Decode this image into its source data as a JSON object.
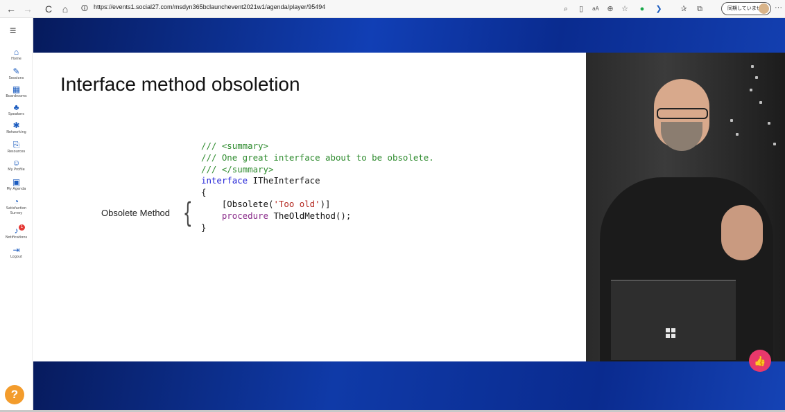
{
  "browser": {
    "back": "←",
    "forward": "→",
    "reload": "C",
    "home": "⌂",
    "lock": "🛈",
    "url": "https://events1.social27.com/msdyn365bclaunchevent2021w1/agenda/player/95494",
    "toolbar_icons": [
      "search-icon",
      "reader-icon",
      "font-icon",
      "zoom-icon",
      "favorites-add-icon",
      "extension-green-icon",
      "extension-blue-icon",
      "favorites-icon",
      "collections-icon"
    ],
    "profile_label": "同期していません",
    "more": "···"
  },
  "sidebar": {
    "menu": "≡",
    "items": [
      {
        "label": "Home",
        "icon": "home-icon",
        "glyph": "⌂"
      },
      {
        "label": "Sessions",
        "icon": "pencil-icon",
        "glyph": "✎"
      },
      {
        "label": "Boardrooms",
        "icon": "boardroom-icon",
        "glyph": "▦"
      },
      {
        "label": "Speakers",
        "icon": "speaker-icon",
        "glyph": "♣"
      },
      {
        "label": "Networking",
        "icon": "networking-icon",
        "glyph": "✱"
      },
      {
        "label": "Resources",
        "icon": "resources-icon",
        "glyph": "⎘"
      },
      {
        "label": "My Profile",
        "icon": "profile-icon",
        "glyph": "☺"
      },
      {
        "label": "My Agenda",
        "icon": "agenda-icon",
        "glyph": "▣"
      },
      {
        "label": "Satisfaction Survey",
        "icon": "survey-icon",
        "glyph": "◔"
      },
      {
        "label": "Notifications",
        "icon": "bell-icon",
        "glyph": "♪",
        "badge": "1"
      },
      {
        "label": "Logout",
        "icon": "logout-icon",
        "glyph": "⇥"
      }
    ],
    "help": "?"
  },
  "slide": {
    "title": "Interface method obsoletion",
    "code_lines": [
      {
        "cls": "cm",
        "text": "/// <summary>"
      },
      {
        "cls": "cm",
        "text": "/// One great interface about to be obsolete."
      },
      {
        "cls": "cm",
        "text": "/// </summary>"
      },
      {
        "parts": [
          {
            "cls": "kw",
            "text": "interface"
          },
          {
            "cls": "tx",
            "text": " ITheInterface"
          }
        ]
      },
      {
        "cls": "tx",
        "text": "{"
      },
      {
        "parts": [
          {
            "cls": "tx",
            "text": "    [Obsolete("
          },
          {
            "cls": "str",
            "text": "'Too old'"
          },
          {
            "cls": "tx",
            "text": ")]"
          }
        ]
      },
      {
        "parts": [
          {
            "cls": "kp",
            "text": "    procedure"
          },
          {
            "cls": "tx",
            "text": " TheOldMethod();"
          }
        ]
      },
      {
        "cls": "tx",
        "text": "}"
      }
    ],
    "annotation": "Obsolete Method",
    "brace": "{"
  },
  "player": {
    "like_icon": "thumbs-up-icon",
    "like_glyph": "👍",
    "colors": {
      "like": "#e8386b",
      "help": "#f39c2c",
      "accent": "#1a5bbf"
    }
  }
}
